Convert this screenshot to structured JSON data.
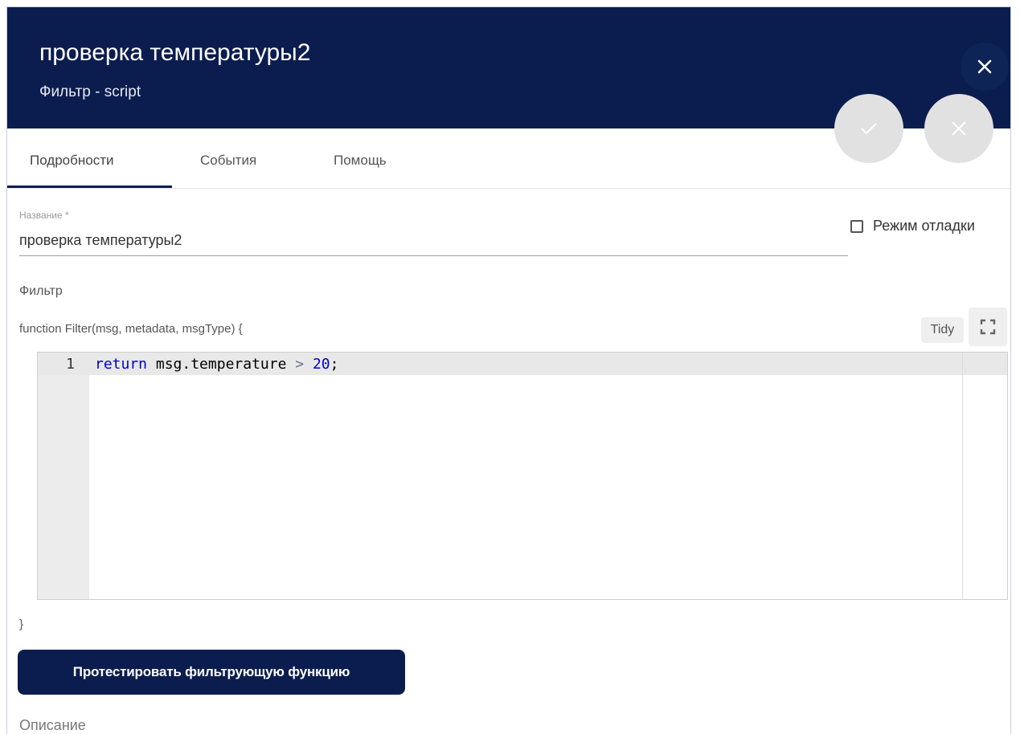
{
  "header": {
    "title": "проверка температуры2",
    "subtitle": "Фильтр - script",
    "close_icon": "close-icon"
  },
  "fab": {
    "apply_icon": "check-icon",
    "cancel_icon": "close-icon"
  },
  "tabs": [
    {
      "label": "Подробности",
      "active": true
    },
    {
      "label": "События",
      "active": false
    },
    {
      "label": "Помощь",
      "active": false
    }
  ],
  "name_field": {
    "label": "Название *",
    "value": "проверка температуры2"
  },
  "debug_mode": {
    "label": "Режим отладки",
    "checked": false
  },
  "filter": {
    "section_label": "Фильтр",
    "function_signature": "function Filter(msg, metadata, msgType) {",
    "tidy_label": "Tidy",
    "fullscreen_icon": "fullscreen-icon",
    "closing_brace": "}",
    "code_lines": [
      {
        "number": "1",
        "keyword": "return",
        "body": " msg.temperature ",
        "operator": ">",
        "space": " ",
        "number_literal": "20",
        "end": ";"
      }
    ]
  },
  "test_button_label": "Протестировать фильтрующую функцию",
  "description_label": "Описание",
  "colors": {
    "header_bg": "#0b1d4f",
    "accent": "#0b1d4f",
    "fab_bg": "#e1e1e1"
  }
}
